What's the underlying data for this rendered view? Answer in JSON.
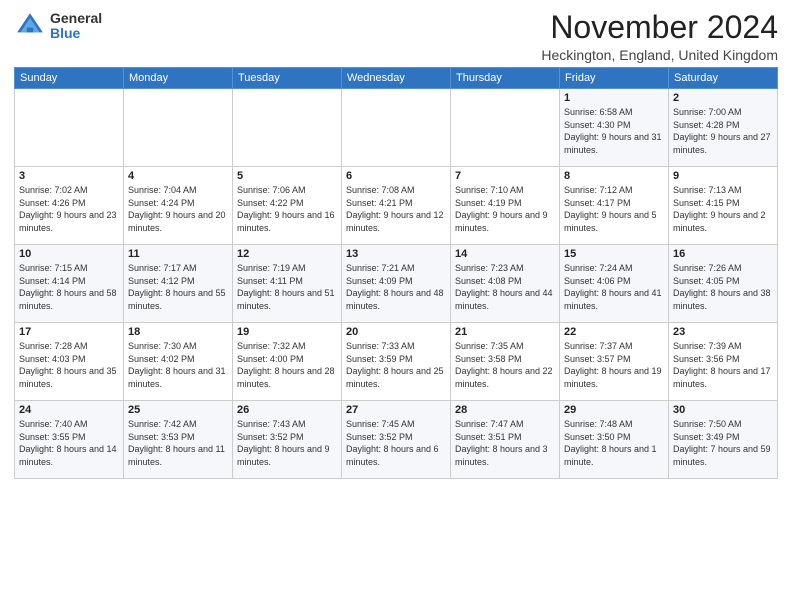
{
  "logo": {
    "general": "General",
    "blue": "Blue"
  },
  "title": "November 2024",
  "location": "Heckington, England, United Kingdom",
  "days_of_week": [
    "Sunday",
    "Monday",
    "Tuesday",
    "Wednesday",
    "Thursday",
    "Friday",
    "Saturday"
  ],
  "weeks": [
    [
      {
        "day": "",
        "detail": ""
      },
      {
        "day": "",
        "detail": ""
      },
      {
        "day": "",
        "detail": ""
      },
      {
        "day": "",
        "detail": ""
      },
      {
        "day": "",
        "detail": ""
      },
      {
        "day": "1",
        "detail": "Sunrise: 6:58 AM\nSunset: 4:30 PM\nDaylight: 9 hours and 31 minutes."
      },
      {
        "day": "2",
        "detail": "Sunrise: 7:00 AM\nSunset: 4:28 PM\nDaylight: 9 hours and 27 minutes."
      }
    ],
    [
      {
        "day": "3",
        "detail": "Sunrise: 7:02 AM\nSunset: 4:26 PM\nDaylight: 9 hours and 23 minutes."
      },
      {
        "day": "4",
        "detail": "Sunrise: 7:04 AM\nSunset: 4:24 PM\nDaylight: 9 hours and 20 minutes."
      },
      {
        "day": "5",
        "detail": "Sunrise: 7:06 AM\nSunset: 4:22 PM\nDaylight: 9 hours and 16 minutes."
      },
      {
        "day": "6",
        "detail": "Sunrise: 7:08 AM\nSunset: 4:21 PM\nDaylight: 9 hours and 12 minutes."
      },
      {
        "day": "7",
        "detail": "Sunrise: 7:10 AM\nSunset: 4:19 PM\nDaylight: 9 hours and 9 minutes."
      },
      {
        "day": "8",
        "detail": "Sunrise: 7:12 AM\nSunset: 4:17 PM\nDaylight: 9 hours and 5 minutes."
      },
      {
        "day": "9",
        "detail": "Sunrise: 7:13 AM\nSunset: 4:15 PM\nDaylight: 9 hours and 2 minutes."
      }
    ],
    [
      {
        "day": "10",
        "detail": "Sunrise: 7:15 AM\nSunset: 4:14 PM\nDaylight: 8 hours and 58 minutes."
      },
      {
        "day": "11",
        "detail": "Sunrise: 7:17 AM\nSunset: 4:12 PM\nDaylight: 8 hours and 55 minutes."
      },
      {
        "day": "12",
        "detail": "Sunrise: 7:19 AM\nSunset: 4:11 PM\nDaylight: 8 hours and 51 minutes."
      },
      {
        "day": "13",
        "detail": "Sunrise: 7:21 AM\nSunset: 4:09 PM\nDaylight: 8 hours and 48 minutes."
      },
      {
        "day": "14",
        "detail": "Sunrise: 7:23 AM\nSunset: 4:08 PM\nDaylight: 8 hours and 44 minutes."
      },
      {
        "day": "15",
        "detail": "Sunrise: 7:24 AM\nSunset: 4:06 PM\nDaylight: 8 hours and 41 minutes."
      },
      {
        "day": "16",
        "detail": "Sunrise: 7:26 AM\nSunset: 4:05 PM\nDaylight: 8 hours and 38 minutes."
      }
    ],
    [
      {
        "day": "17",
        "detail": "Sunrise: 7:28 AM\nSunset: 4:03 PM\nDaylight: 8 hours and 35 minutes."
      },
      {
        "day": "18",
        "detail": "Sunrise: 7:30 AM\nSunset: 4:02 PM\nDaylight: 8 hours and 31 minutes."
      },
      {
        "day": "19",
        "detail": "Sunrise: 7:32 AM\nSunset: 4:00 PM\nDaylight: 8 hours and 28 minutes."
      },
      {
        "day": "20",
        "detail": "Sunrise: 7:33 AM\nSunset: 3:59 PM\nDaylight: 8 hours and 25 minutes."
      },
      {
        "day": "21",
        "detail": "Sunrise: 7:35 AM\nSunset: 3:58 PM\nDaylight: 8 hours and 22 minutes."
      },
      {
        "day": "22",
        "detail": "Sunrise: 7:37 AM\nSunset: 3:57 PM\nDaylight: 8 hours and 19 minutes."
      },
      {
        "day": "23",
        "detail": "Sunrise: 7:39 AM\nSunset: 3:56 PM\nDaylight: 8 hours and 17 minutes."
      }
    ],
    [
      {
        "day": "24",
        "detail": "Sunrise: 7:40 AM\nSunset: 3:55 PM\nDaylight: 8 hours and 14 minutes."
      },
      {
        "day": "25",
        "detail": "Sunrise: 7:42 AM\nSunset: 3:53 PM\nDaylight: 8 hours and 11 minutes."
      },
      {
        "day": "26",
        "detail": "Sunrise: 7:43 AM\nSunset: 3:52 PM\nDaylight: 8 hours and 9 minutes."
      },
      {
        "day": "27",
        "detail": "Sunrise: 7:45 AM\nSunset: 3:52 PM\nDaylight: 8 hours and 6 minutes."
      },
      {
        "day": "28",
        "detail": "Sunrise: 7:47 AM\nSunset: 3:51 PM\nDaylight: 8 hours and 3 minutes."
      },
      {
        "day": "29",
        "detail": "Sunrise: 7:48 AM\nSunset: 3:50 PM\nDaylight: 8 hours and 1 minute."
      },
      {
        "day": "30",
        "detail": "Sunrise: 7:50 AM\nSunset: 3:49 PM\nDaylight: 7 hours and 59 minutes."
      }
    ]
  ]
}
